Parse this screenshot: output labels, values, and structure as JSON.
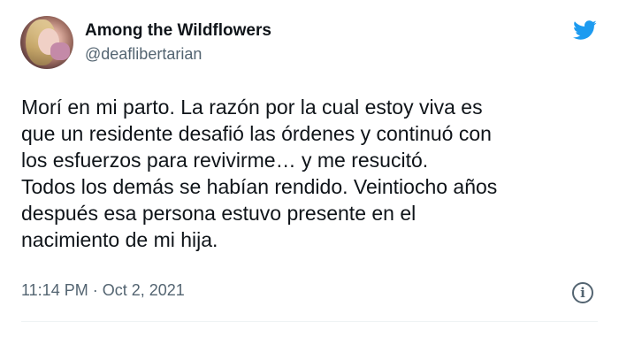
{
  "author": {
    "display_name": "Among the Wildflowers",
    "handle": "@deaflibertarian"
  },
  "tweet": {
    "lines": [
      "Morí en mi parto. La razón por la cual estoy viva es",
      "que un residente desafió las órdenes y continuó con",
      "los esfuerzos para revivirme… y me resucitó.",
      "Todos los demás se habían rendido. Veintiocho años",
      "después esa persona estuvo presente en el",
      "nacimiento de mi hija."
    ],
    "time": "11:14 PM",
    "separator": "·",
    "date": "Oct 2, 2021"
  },
  "icons": {
    "brand": "twitter-bird-icon",
    "info": "info-icon",
    "info_glyph": "i"
  },
  "colors": {
    "brand": "#1d9bf0",
    "text_primary": "#0f1419",
    "text_secondary": "#536471"
  }
}
